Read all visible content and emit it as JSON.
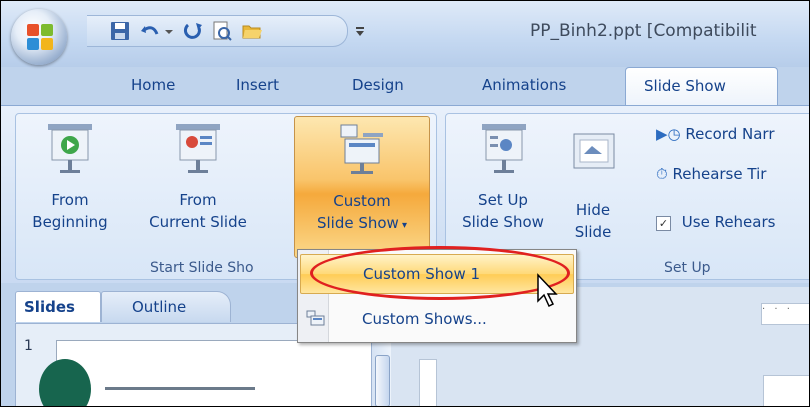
{
  "app": {
    "document_title": "PP_Binh2.ppt [Compatibilit"
  },
  "tabs": [
    "Home",
    "Insert",
    "Design",
    "Animations",
    "Slide Show"
  ],
  "active_tab": "Slide Show",
  "ribbon": {
    "start_group": {
      "label": "Start Slide Sho",
      "from_beginning": [
        "From",
        "Beginning"
      ],
      "from_current": [
        "From",
        "Current Slide"
      ],
      "custom_show": [
        "Custom",
        "Slide Show"
      ]
    },
    "setup_group": {
      "label": "Set Up",
      "set_up": [
        "Set Up",
        "Slide Show"
      ],
      "hide": [
        "Hide",
        "Slide"
      ],
      "record": "Record Narr",
      "rehearse": "Rehearse Tir",
      "use_rehearsed": "Use Rehears"
    }
  },
  "dropdown": {
    "items": [
      "Custom Show 1",
      "Custom Shows..."
    ]
  },
  "pane": {
    "tabs": [
      "Slides",
      "Outline"
    ],
    "slide_number": "1"
  },
  "colors": {
    "ribbon_text": "#15428b",
    "highlight": "#f9c46a",
    "annotation_ring": "#e02020"
  }
}
